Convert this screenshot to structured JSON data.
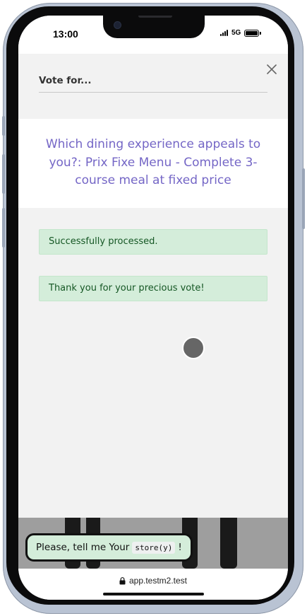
{
  "status_bar": {
    "time": "13:00",
    "network": "5G"
  },
  "vote_panel": {
    "title": "Vote for...",
    "question": "Which dining experience appeals to you?: Prix Fixe Menu - Complete 3-course meal at fixed price",
    "close_icon": "close-icon"
  },
  "alerts": [
    {
      "text": "Successfully processed."
    },
    {
      "text": "Thank you for your precious vote!"
    }
  ],
  "toast": {
    "prefix": "Please, tell me Your",
    "code": "store(y)",
    "suffix": "!"
  },
  "browser": {
    "url": "app.testm2.test",
    "lock_icon": "lock-icon"
  },
  "colors": {
    "question_text": "#7466c6",
    "alert_bg": "#d4edda",
    "alert_text": "#155724",
    "panel_bg": "#f2f2f2"
  }
}
